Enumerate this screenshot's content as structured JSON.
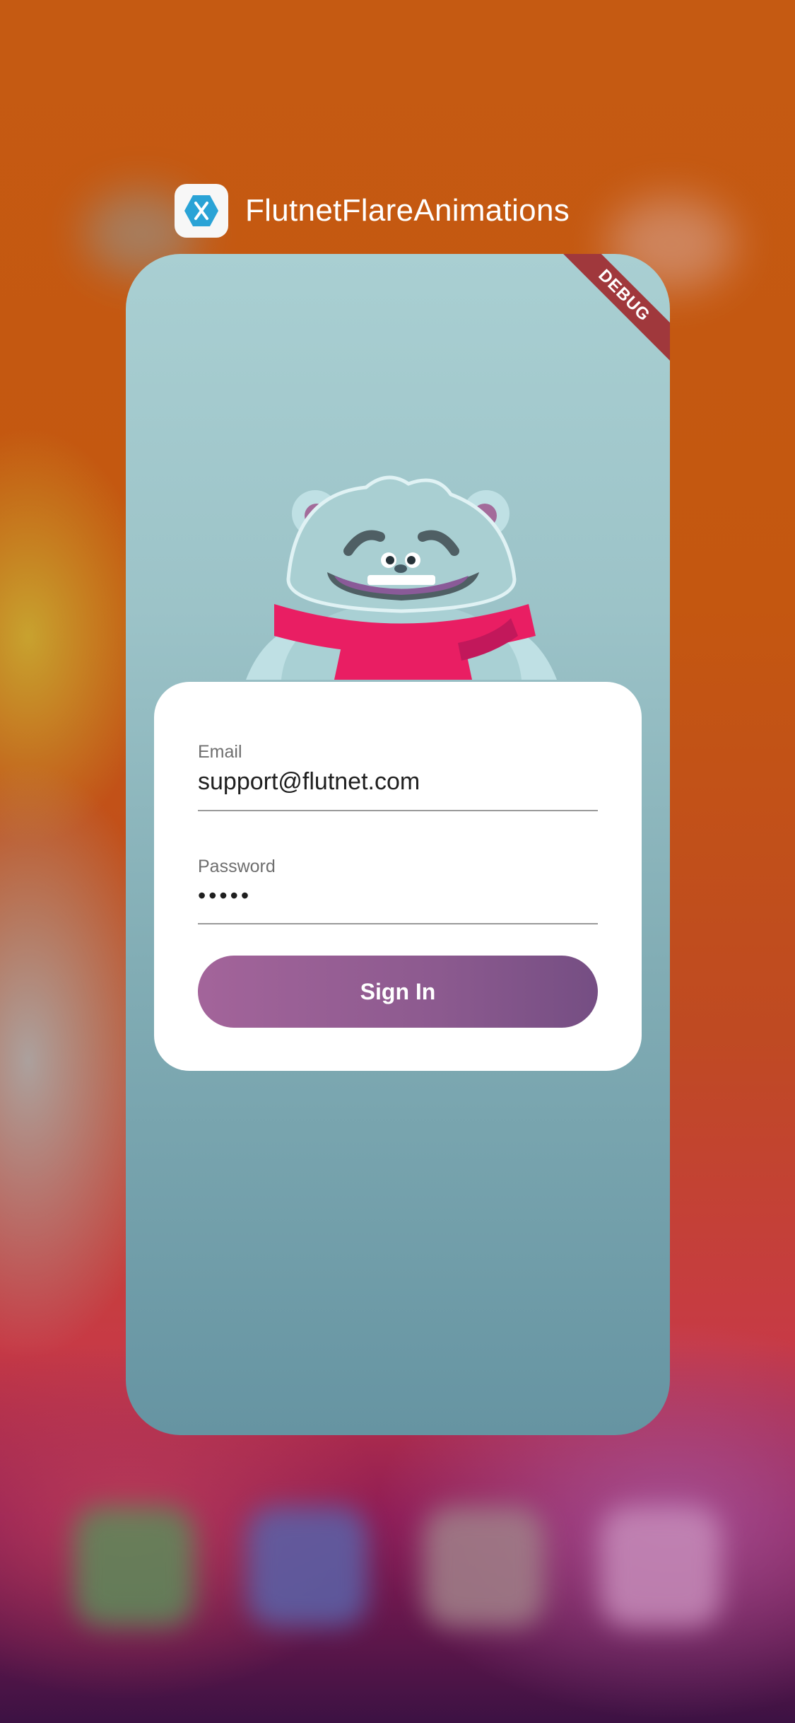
{
  "app": {
    "title": "FlutnetFlareAnimations",
    "icon": "xamarin-hexagon-icon"
  },
  "debug_banner": "DEBUG",
  "login": {
    "email_label": "Email",
    "email_value": "support@flutnet.com",
    "password_label": "Password",
    "password_value": "•••••",
    "signin_label": "Sign In"
  },
  "colors": {
    "card_top": "#a9cfd2",
    "card_bottom": "#6694a2",
    "button_start": "#a3649a",
    "button_end": "#754e83",
    "scarf": "#e91e63"
  }
}
